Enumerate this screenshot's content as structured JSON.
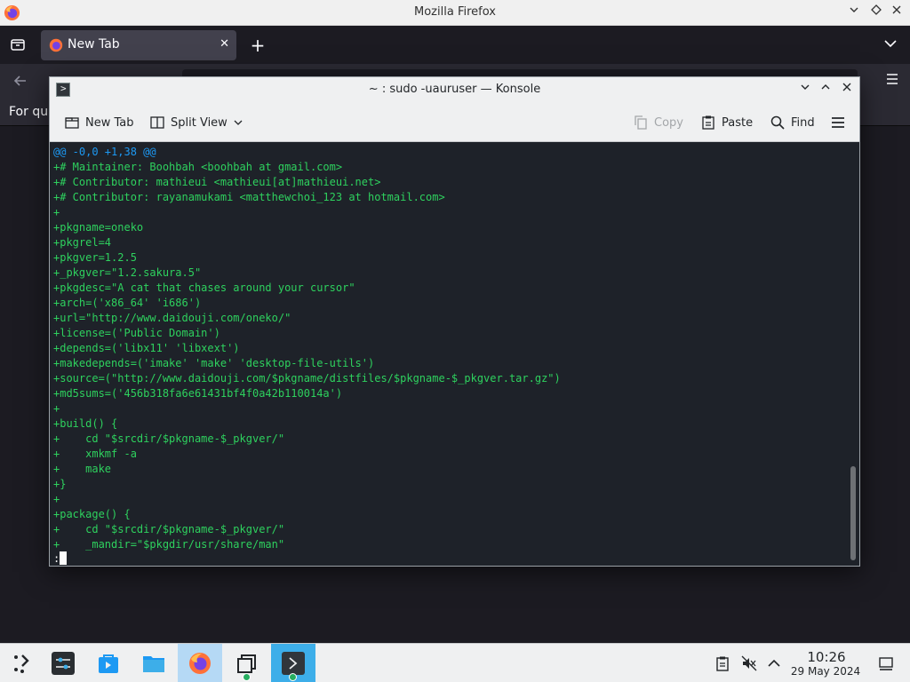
{
  "firefox": {
    "window_title": "Mozilla Firefox",
    "tab_label": "New Tab",
    "new_tab_symbol": "+",
    "tab_close_symbol": "✕",
    "bookmarks_text": "For qui",
    "icons": [
      "firefox-icon",
      "tabs-list-icon",
      "new-tab-icon",
      "list-all-tabs-icon",
      "back-arrow-icon",
      "hamburger-menu-icon"
    ]
  },
  "konsole": {
    "window_title": "~ : sudo -uauruser — Konsole",
    "toolbar": {
      "new_tab": "New Tab",
      "split_view": "Split View",
      "copy": "Copy",
      "paste": "Paste",
      "find": "Find"
    },
    "terminal_lines": [
      {
        "kind": "hunk",
        "text": "@@ -0,0 +1,38 @@"
      },
      {
        "kind": "add",
        "text": "+# Maintainer: Boohbah <boohbah at gmail.com>"
      },
      {
        "kind": "add",
        "text": "+# Contributor: mathieui <mathieui[at]mathieui.net>"
      },
      {
        "kind": "add",
        "text": "+# Contributor: rayanamukami <matthewchoi_123 at hotmail.com>"
      },
      {
        "kind": "add",
        "text": "+"
      },
      {
        "kind": "add",
        "text": "+pkgname=oneko"
      },
      {
        "kind": "add",
        "text": "+pkgrel=4"
      },
      {
        "kind": "add",
        "text": "+pkgver=1.2.5"
      },
      {
        "kind": "add",
        "text": "+_pkgver=\"1.2.sakura.5\""
      },
      {
        "kind": "add",
        "text": "+pkgdesc=\"A cat that chases around your cursor\""
      },
      {
        "kind": "add",
        "text": "+arch=('x86_64' 'i686')"
      },
      {
        "kind": "add",
        "text": "+url=\"http://www.daidouji.com/oneko/\""
      },
      {
        "kind": "add",
        "text": "+license=('Public Domain')"
      },
      {
        "kind": "add",
        "text": "+depends=('libx11' 'libxext')"
      },
      {
        "kind": "add",
        "text": "+makedepends=('imake' 'make' 'desktop-file-utils')"
      },
      {
        "kind": "add",
        "text": "+source=(\"http://www.daidouji.com/$pkgname/distfiles/$pkgname-$_pkgver.tar.gz\")"
      },
      {
        "kind": "add",
        "text": "+md5sums=('456b318fa6e61431bf4f0a42b110014a')"
      },
      {
        "kind": "add",
        "text": "+"
      },
      {
        "kind": "add",
        "text": "+build() {"
      },
      {
        "kind": "add",
        "text": "+    cd \"$srcdir/$pkgname-$_pkgver/\""
      },
      {
        "kind": "add",
        "text": "+    xmkmf -a"
      },
      {
        "kind": "add",
        "text": "+    make"
      },
      {
        "kind": "add",
        "text": "+}"
      },
      {
        "kind": "add",
        "text": "+"
      },
      {
        "kind": "add",
        "text": "+package() {"
      },
      {
        "kind": "add",
        "text": "+    cd \"$srcdir/$pkgname-$_pkgver/\""
      },
      {
        "kind": "add",
        "text": "+    _mandir=\"$pkgdir/usr/share/man\""
      }
    ],
    "prompt": ":",
    "colors": {
      "hunk": "#1d99f3",
      "added": "#2ed15e",
      "background": "#1e2229"
    }
  },
  "taskbar": {
    "clock_time": "10:26",
    "clock_date": "29 May 2024",
    "items": [
      "application-launcher-icon",
      "system-settings-icon",
      "discover-store-icon",
      "file-manager-icon",
      "firefox-icon",
      "task-switcher-icon",
      "konsole-icon"
    ],
    "tray": [
      "clipboard-icon",
      "volume-muted-icon",
      "show-hidden-icons-icon",
      "show-desktop-icon"
    ]
  }
}
